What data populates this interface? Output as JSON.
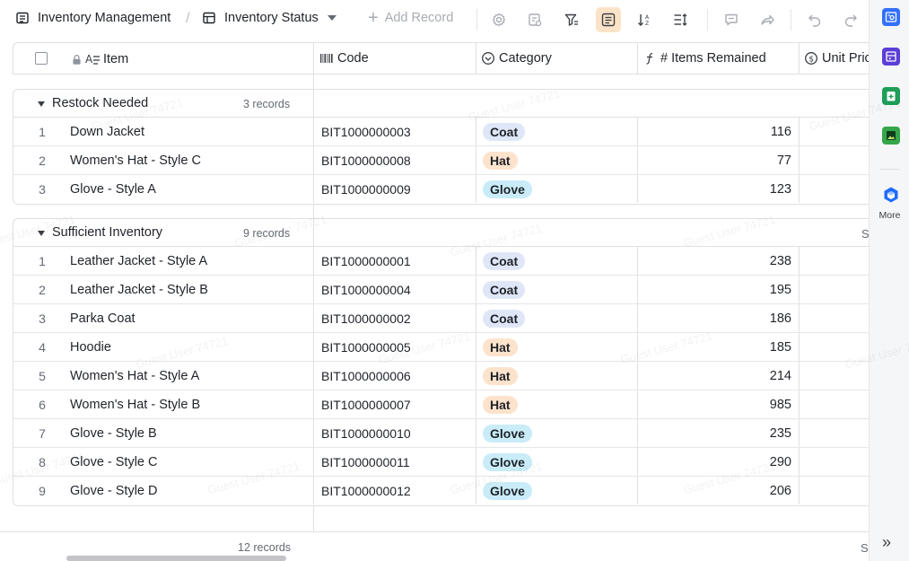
{
  "toolbar": {
    "title": "Inventory Management",
    "view_name": "Inventory Status",
    "add_record": "Add Record"
  },
  "columns": {
    "item": "Item",
    "code": "Code",
    "category": "Category",
    "items_remained": "# Items Remained",
    "unit_price": "Unit Pric"
  },
  "groups": [
    {
      "name": "Restock Needed",
      "count": "3 records",
      "rows": [
        {
          "num": "1",
          "item": "Down Jacket",
          "code": "BIT1000000003",
          "category": "Coat",
          "remained": "116"
        },
        {
          "num": "2",
          "item": "Women's Hat - Style C",
          "code": "BIT1000000008",
          "category": "Hat",
          "remained": "77"
        },
        {
          "num": "3",
          "item": "Glove - Style A",
          "code": "BIT1000000009",
          "category": "Glove",
          "remained": "123"
        }
      ]
    },
    {
      "name": "Sufficient Inventory",
      "count": "9 records",
      "summary_cut": "S",
      "rows": [
        {
          "num": "1",
          "item": "Leather Jacket - Style A",
          "code": "BIT1000000001",
          "category": "Coat",
          "remained": "238"
        },
        {
          "num": "2",
          "item": "Leather Jacket - Style B",
          "code": "BIT1000000004",
          "category": "Coat",
          "remained": "195"
        },
        {
          "num": "3",
          "item": "Parka Coat",
          "code": "BIT1000000002",
          "category": "Coat",
          "remained": "186"
        },
        {
          "num": "4",
          "item": "Hoodie",
          "code": "BIT1000000005",
          "category": "Hat",
          "remained": "185"
        },
        {
          "num": "5",
          "item": "Women's Hat - Style A",
          "code": "BIT1000000006",
          "category": "Hat",
          "remained": "214"
        },
        {
          "num": "6",
          "item": "Women's Hat - Style B",
          "code": "BIT1000000007",
          "category": "Hat",
          "remained": "985"
        },
        {
          "num": "7",
          "item": "Glove - Style B",
          "code": "BIT1000000010",
          "category": "Glove",
          "remained": "235"
        },
        {
          "num": "8",
          "item": "Glove - Style C",
          "code": "BIT1000000011",
          "category": "Glove",
          "remained": "290"
        },
        {
          "num": "9",
          "item": "Glove - Style D",
          "code": "BIT1000000012",
          "category": "Glove",
          "remained": "206"
        }
      ]
    }
  ],
  "footer": {
    "total": "12 records",
    "summary_cut": "S"
  },
  "side_panel": {
    "more_label": "More"
  },
  "watermark": "Guest User 74721",
  "tag_colors": {
    "Coat": {
      "bg": "#dfe6f7",
      "fg": "#1f2329"
    },
    "Hat": {
      "bg": "#fde2cc",
      "fg": "#1f2329"
    },
    "Glove": {
      "bg": "#c9ecf8",
      "fg": "#1f2329"
    }
  }
}
